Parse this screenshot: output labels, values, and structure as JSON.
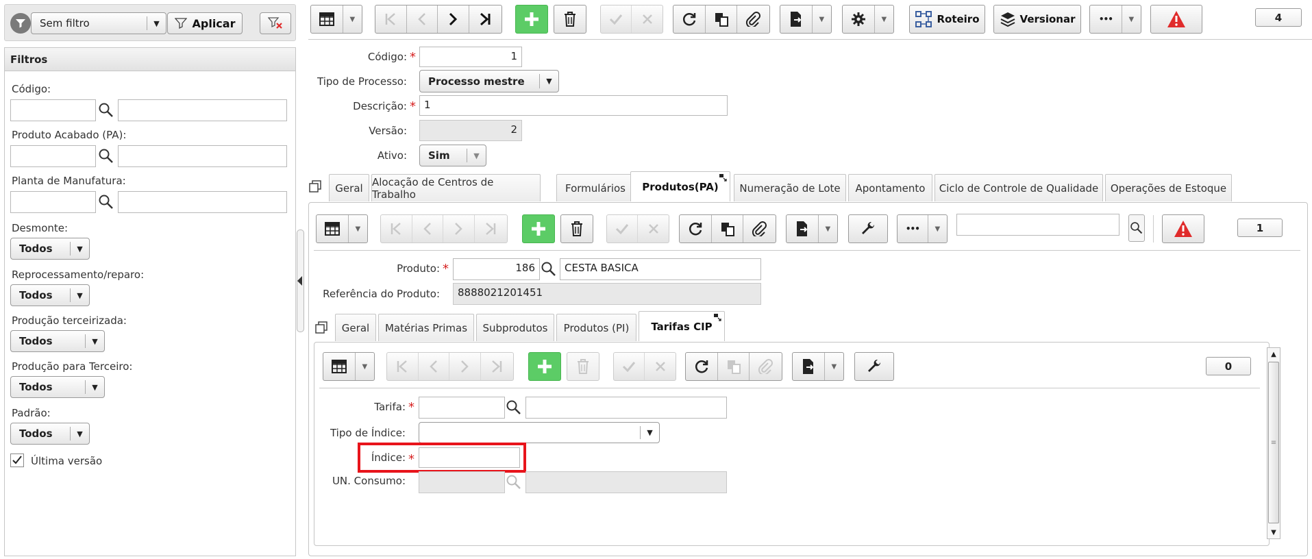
{
  "filter_bar": {
    "filter_select": "Sem filtro",
    "apply_label": "Aplicar"
  },
  "filters_panel": {
    "title": "Filtros",
    "codigo_label": "Código:",
    "produto_label": "Produto Acabado (PA):",
    "planta_label": "Planta de Manufatura:",
    "desmonte_label": "Desmonte:",
    "desmonte_value": "Todos",
    "reprocess_label": "Reprocessamento/reparo:",
    "reprocess_value": "Todos",
    "terceirizada_label": "Produção terceirizada:",
    "terceirizada_value": "Todos",
    "para_terceiro_label": "Produção para Terceiro:",
    "para_terceiro_value": "Todos",
    "padrao_label": "Padrão:",
    "padrao_value": "Todos",
    "ultima_versao_label": "Última versão",
    "ultima_versao_checked": true
  },
  "main_toolbar": {
    "roteiro_label": "Roteiro",
    "versionar_label": "Versionar",
    "more_label": "•••",
    "count": "4"
  },
  "form": {
    "codigo_label": "Código:",
    "codigo_value": "1",
    "tipo_label": "Tipo de Processo:",
    "tipo_value": "Processo mestre",
    "descricao_label": "Descrição:",
    "descricao_value": "1",
    "versao_label": "Versão:",
    "versao_value": "2",
    "ativo_label": "Ativo:",
    "ativo_value": "Sim"
  },
  "tabs": [
    {
      "label": "Geral"
    },
    {
      "label": "Alocação de Centros de Trabalho"
    },
    {
      "label": "Formulários"
    },
    {
      "label": "Produtos(PA)"
    },
    {
      "label": "Numeração de Lote"
    },
    {
      "label": "Apontamento"
    },
    {
      "label": "Ciclo de Controle de Qualidade"
    },
    {
      "label": "Operações de Estoque"
    }
  ],
  "pa_toolbar": {
    "more_label": "•••",
    "search_value": "",
    "count": "1"
  },
  "pa_form": {
    "produto_label": "Produto:",
    "produto_code": "186",
    "produto_name": "CESTA BASICA",
    "referencia_label": "Referência do Produto:",
    "referencia_value": "8888021201451"
  },
  "sub_tabs": [
    {
      "label": "Geral"
    },
    {
      "label": "Matérias Primas"
    },
    {
      "label": "Subprodutos"
    },
    {
      "label": "Produtos (PI)"
    },
    {
      "label": "Tarifas CIP"
    }
  ],
  "cip_toolbar": {
    "count": "0"
  },
  "cip_form": {
    "tarifa_label": "Tarifa:",
    "tarifa_value": "",
    "tarifa_desc": "",
    "tipo_indice_label": "Tipo de Índice:",
    "tipo_indice_value": "",
    "indice_label": "Índice:",
    "indice_value": "",
    "un_consumo_label": "UN. Consumo:",
    "un_consumo_value": "",
    "un_consumo_desc": ""
  },
  "colors": {
    "green": "#5ccc66",
    "required": "#d62020",
    "highlight": "#e8141b",
    "alert": "#e02b2b"
  }
}
